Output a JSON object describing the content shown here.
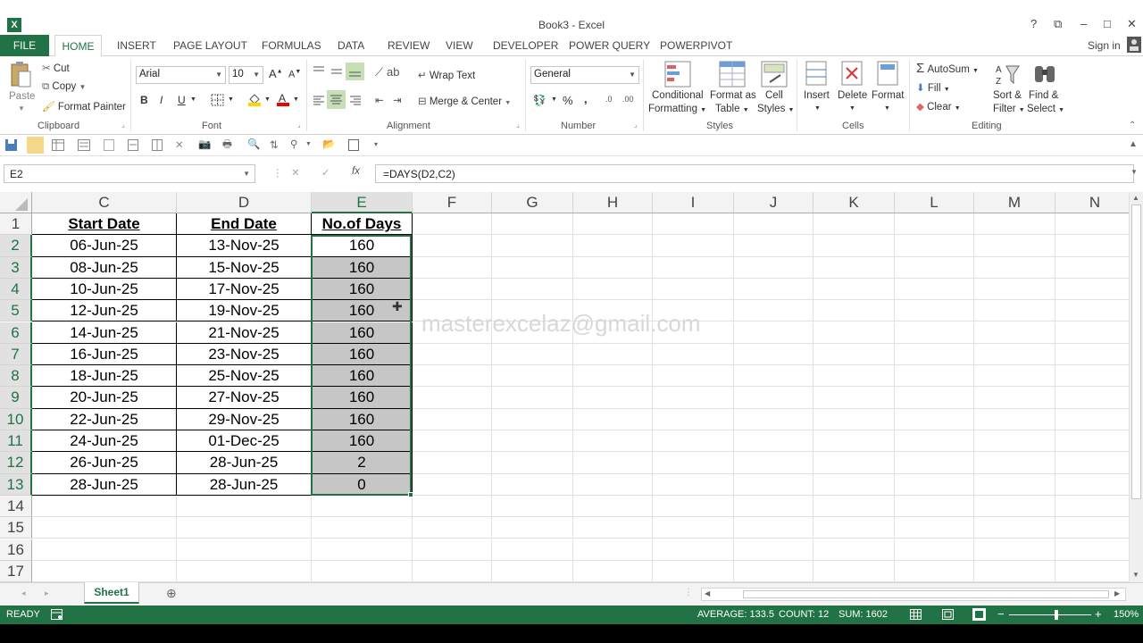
{
  "window": {
    "title": "Book3 - Excel",
    "help": "?",
    "restore": "⧉",
    "minimize": "–",
    "maximize": "□",
    "close": "✕"
  },
  "tabs": {
    "file": "FILE",
    "home": "HOME",
    "items": [
      "INSERT",
      "PAGE LAYOUT",
      "FORMULAS",
      "DATA",
      "REVIEW",
      "VIEW",
      "DEVELOPER",
      "POWER QUERY",
      "POWERPIVOT"
    ],
    "signin": "Sign in"
  },
  "ribbon": {
    "clipboard": {
      "paste": "Paste",
      "cut": "Cut",
      "copy": "Copy",
      "format_painter": "Format Painter",
      "label": "Clipboard"
    },
    "font": {
      "name": "Arial",
      "size": "10",
      "bold": "B",
      "italic": "I",
      "underline": "U",
      "label": "Font"
    },
    "alignment": {
      "wrap": "Wrap Text",
      "merge": "Merge & Center",
      "label": "Alignment"
    },
    "number": {
      "format": "General",
      "percent": "%",
      "comma": ",",
      "label": "Number"
    },
    "styles": {
      "conditional": "Conditional",
      "conditional2": "Formatting",
      "format_table": "Format as",
      "format_table2": "Table",
      "cell_styles": "Cell",
      "cell_styles2": "Styles",
      "label": "Styles"
    },
    "cells": {
      "insert": "Insert",
      "delete": "Delete",
      "format": "Format",
      "label": "Cells"
    },
    "editing": {
      "autosum": "AutoSum",
      "fill": "Fill",
      "clear": "Clear",
      "sort": "Sort &",
      "sort2": "Filter",
      "find": "Find &",
      "find2": "Select",
      "label": "Editing"
    }
  },
  "formula_bar": {
    "name_box": "E2",
    "fx": "fx",
    "formula": "=DAYS(D2,C2)"
  },
  "columns": [
    "C",
    "D",
    "E",
    "F",
    "G",
    "H",
    "I",
    "J",
    "K",
    "L",
    "M",
    "N"
  ],
  "rows": [
    "1",
    "2",
    "3",
    "4",
    "5",
    "6",
    "7",
    "8",
    "9",
    "10",
    "11",
    "12",
    "13",
    "14",
    "15",
    "16",
    "17"
  ],
  "table": {
    "headers": [
      "Start Date",
      "End Date",
      "No.of Days"
    ],
    "data": [
      [
        "06-Jun-25",
        "13-Nov-25",
        "160"
      ],
      [
        "08-Jun-25",
        "15-Nov-25",
        "160"
      ],
      [
        "10-Jun-25",
        "17-Nov-25",
        "160"
      ],
      [
        "12-Jun-25",
        "19-Nov-25",
        "160"
      ],
      [
        "14-Jun-25",
        "21-Nov-25",
        "160"
      ],
      [
        "16-Jun-25",
        "23-Nov-25",
        "160"
      ],
      [
        "18-Jun-25",
        "25-Nov-25",
        "160"
      ],
      [
        "20-Jun-25",
        "27-Nov-25",
        "160"
      ],
      [
        "22-Jun-25",
        "29-Nov-25",
        "160"
      ],
      [
        "24-Jun-25",
        "01-Dec-25",
        "160"
      ],
      [
        "26-Jun-25",
        "28-Jun-25",
        "2"
      ],
      [
        "28-Jun-25",
        "28-Jun-25",
        "0"
      ]
    ]
  },
  "watermark": "masterexcelaz@gmail.com",
  "sheet_tab": "Sheet1",
  "status": {
    "ready": "READY",
    "average": "AVERAGE: 133.5",
    "count": "COUNT: 12",
    "sum": "SUM: 1602",
    "zoom": "150%"
  },
  "colors": {
    "accent": "#217346",
    "selection_fill": "#c6c6c6"
  }
}
